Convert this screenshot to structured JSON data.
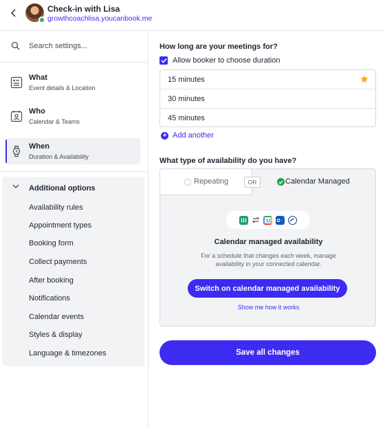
{
  "header": {
    "title": "Check-in with Lisa",
    "link": "growthcoachlisa.youcanbook.me",
    "back_icon": "chevron-left-icon"
  },
  "sidebar": {
    "search": {
      "placeholder": "Search settings...",
      "value": ""
    },
    "nav": [
      {
        "title": "What",
        "subtitle": "Event details & Location",
        "icon": "form-icon"
      },
      {
        "title": "Who",
        "subtitle": "Calendar & Teams",
        "icon": "person-calendar-icon"
      },
      {
        "title": "When",
        "subtitle": "Duration & Availability",
        "icon": "watch-icon",
        "active": true
      }
    ],
    "additional": {
      "title": "Additional options",
      "items": [
        "Availability rules",
        "Appointment types",
        "Booking form",
        "Collect payments",
        "After booking",
        "Notifications",
        "Calendar events",
        "Styles & display",
        "Language & timezones"
      ]
    }
  },
  "main": {
    "duration_question": "How long are your meetings for?",
    "allow_choose_label": "Allow booker to choose duration",
    "allow_choose_checked": true,
    "durations": [
      "15 minutes",
      "30 minutes",
      "45 minutes"
    ],
    "default_duration": "15 minutes",
    "add_another": "Add another",
    "availability_question": "What type of availability do you have?",
    "tabs": {
      "repeating": "Repeating",
      "or": "OR",
      "managed": "Calendar Managed",
      "selected": "managed"
    },
    "managed": {
      "title": "Calendar managed availability",
      "description": "For a schedule that changes each week, manage availability in your connected calendar.",
      "button": "Switch on calendar managed availability",
      "link": "Show me how it works"
    },
    "save_button": "Save all changes"
  },
  "colors": {
    "accent": "#3d2bf2",
    "success": "#1fa34a",
    "star": "#f5a623"
  }
}
